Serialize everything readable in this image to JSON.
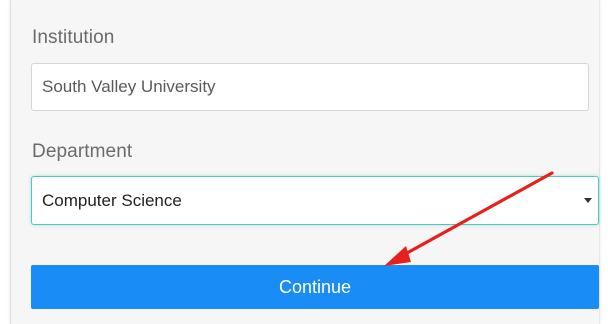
{
  "form": {
    "institution": {
      "label": "Institution",
      "value": "South Valley University"
    },
    "department": {
      "label": "Department",
      "selected": "Computer Science"
    },
    "continue_label": "Continue"
  },
  "colors": {
    "button": "#1a8cf5",
    "select_focus_border": "#4fc9c0",
    "annotation_arrow": "#e8201c",
    "panel_background": "#f6f6f6"
  },
  "icons": {
    "select_caret": "caret-down-icon",
    "annotation": "red-arrow-icon"
  }
}
